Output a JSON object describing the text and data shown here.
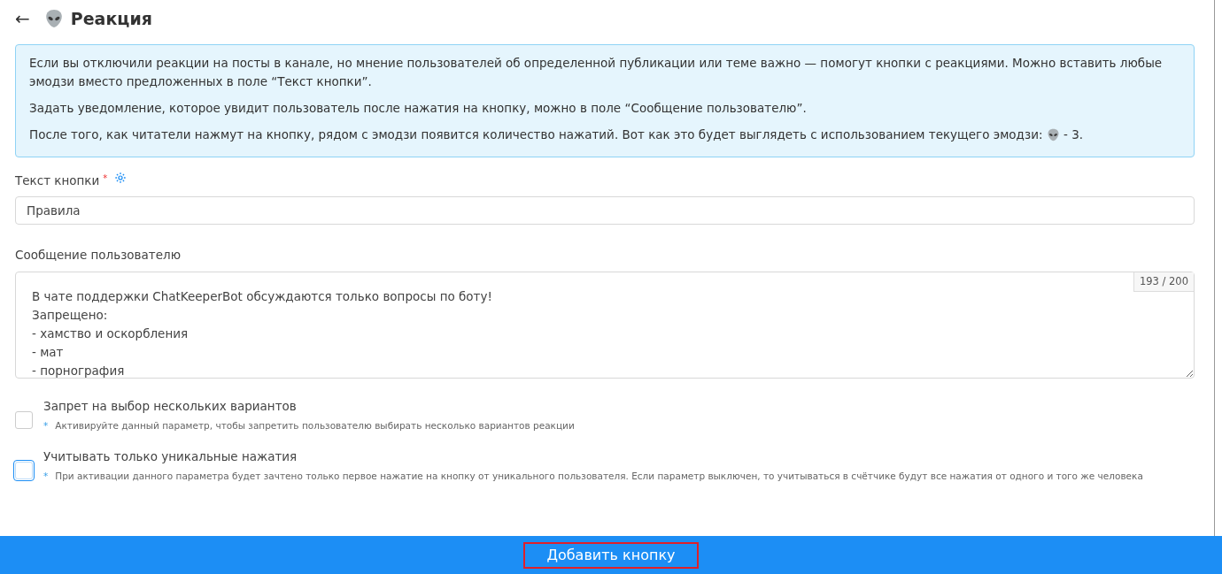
{
  "header": {
    "back": "←",
    "title": "Реакция"
  },
  "info": {
    "paragraphs": [
      {
        "text": "Если вы отключили реакции на посты в канале, но мнение пользователей об определенной публикации или теме важно — помогут кнопки с реакциями. Можно вставить любые эмодзи вместо предложенных в поле “Текст кнопки”."
      },
      {
        "text": "Задать уведомление, которое увидит пользователь после нажатия на кнопку, можно в поле “Сообщение пользователю”."
      },
      {
        "text": "После того, как читатели нажмут на кнопку, рядом с эмодзи появится количество нажатий. Вот как это будет выглядеть с использованием текущего эмодзи:",
        "after_emoji": "- 3."
      }
    ]
  },
  "button_text": {
    "label": "Текст кнопки",
    "required_mark": "*",
    "value": "Правила"
  },
  "message": {
    "label": "Сообщение пользователю",
    "counter": "193 / 200",
    "value": "В чате поддержки ChatKeeperBot обсуждаются только вопросы по боту!\nЗапрещено:\n- хамство и оскорбления\n- мат\n- порнография"
  },
  "options": [
    {
      "label": "Запрет на выбор нескольких вариантов",
      "hint_mark": "*",
      "hint": "Активируйте данный параметр, чтобы запретить пользователю выбирать несколько вариантов реакции",
      "checked": false,
      "focused": false
    },
    {
      "label": "Учитывать только уникальные нажатия",
      "hint_mark": "*",
      "hint": "При активации данного параметра будет зачтено только первое нажатие на кнопку от уникального пользователя. Если параметр выключен, то учитываться в счётчике будут все нажатия от одного и того же человека",
      "checked": false,
      "focused": true
    }
  ],
  "footer": {
    "button": "Добавить кнопку"
  }
}
